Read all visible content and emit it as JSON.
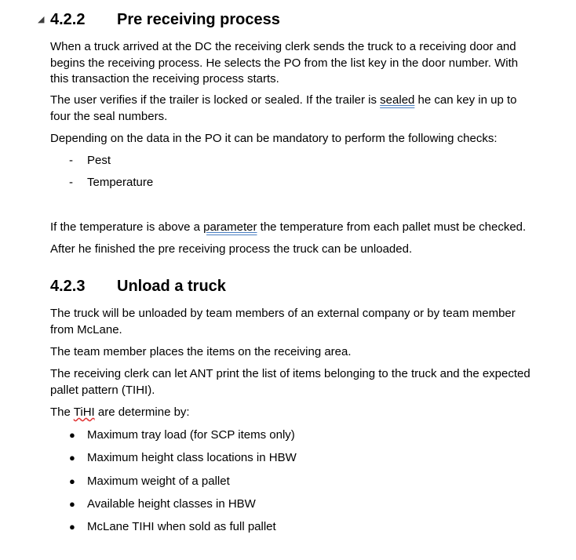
{
  "section_422": {
    "number": "4.2.2",
    "title": "Pre receiving process",
    "p1_line1": "When a truck arrived at the DC the receiving clerk sends the truck to a receiving door and",
    "p1_line2": "begins the receiving process. He selects the PO from the list key in the door number. With",
    "p1_line3": "this transaction the receiving process starts.",
    "p2_before": "The user verifies if the trailer is locked or sealed. If the trailer is ",
    "p2_flagged": "sealed",
    "p2_after": " he can key in up to",
    "p2_line2": "four the seal numbers.",
    "p3": "Depending on the data in the PO it can be mandatory to perform the following checks:",
    "checks": [
      "Pest",
      "Temperature"
    ],
    "p4_before": "If the temperature is above a ",
    "p4_flagged": "parameter",
    "p4_after": " the temperature from each pallet must be checked.",
    "p5": "After he finished the pre receiving process the truck can be unloaded."
  },
  "section_423": {
    "number": "4.2.3",
    "title": "Unload a truck",
    "p1_line1": "The truck will be unloaded by team members of an external company or by team member",
    "p1_line2": "from McLane.",
    "p2": "The team member places the items on the receiving area.",
    "p3_line1": "The receiving clerk can let ANT print the list of items belonging to the truck and the expected",
    "p3_line2": "pallet pattern (TIHI).",
    "p4_before": "The ",
    "p4_flagged": "TiHI",
    "p4_after": " are determine by:",
    "determinants": [
      "Maximum tray load (for SCP items only)",
      "Maximum height class locations in HBW",
      "Maximum weight of a pallet",
      "Available height classes in HBW",
      "McLane TIHI when sold as full pallet"
    ]
  },
  "markers": {
    "dash": "-",
    "bullet": "●",
    "collapse": "◢"
  }
}
